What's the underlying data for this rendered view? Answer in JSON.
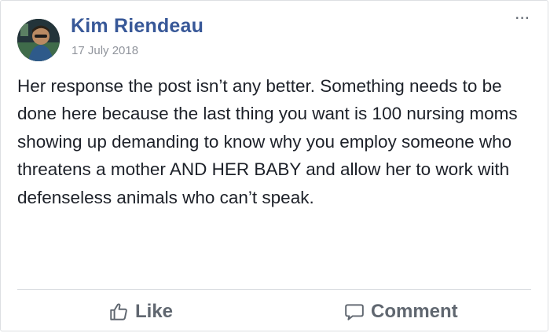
{
  "post": {
    "author": "Kim Riendeau",
    "date": "17 July 2018",
    "more_label": "···",
    "text": "Her response the post isn’t any better. Something needs to be done here because the last thing you want is 100 nursing moms showing up demanding to know why you employ someone who threatens a mother AND HER BABY and allow her to work with defenseless animals who can’t speak."
  },
  "actions": {
    "like_label": "Like",
    "like_icon": "thumbs-up-icon",
    "comment_label": "Comment",
    "comment_icon": "speech-bubble-icon"
  },
  "colors": {
    "author_link": "#385898",
    "text": "#1d2129",
    "muted": "#90949c",
    "action": "#606770"
  }
}
